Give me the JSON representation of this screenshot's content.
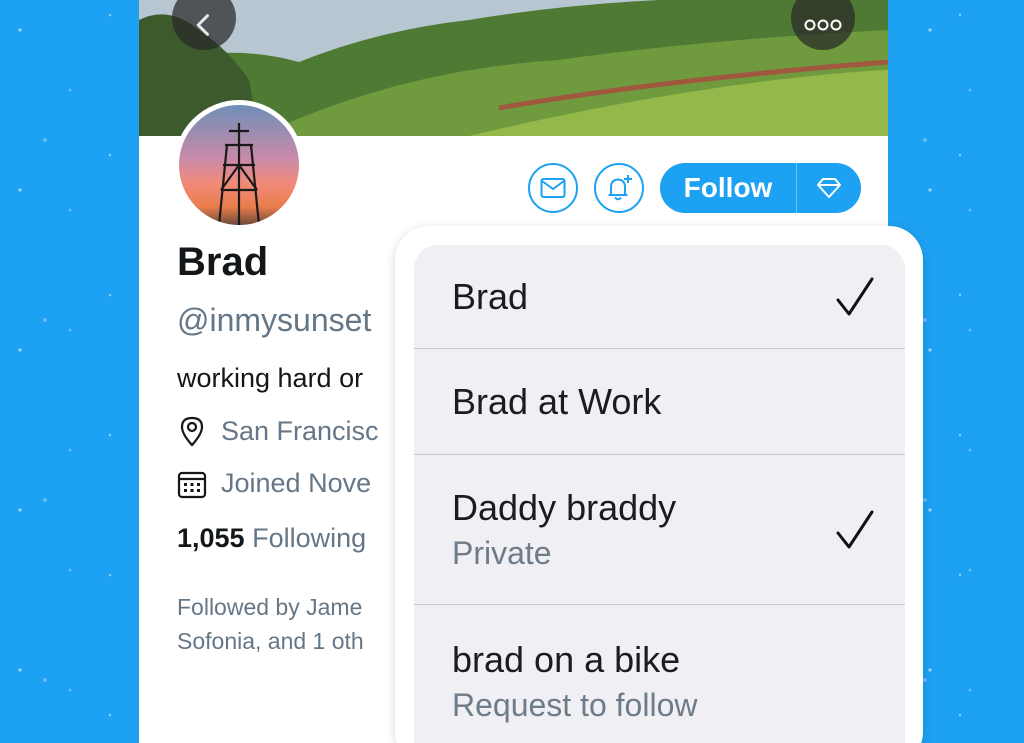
{
  "colors": {
    "brand": "#1DA1F2",
    "card": "#ffffff",
    "menu_bg": "#EFEFF4"
  },
  "header": {
    "back_icon": "chevron-left-icon",
    "more_icon": "more-horizontal-icon"
  },
  "actions": {
    "message_icon": "mail-icon",
    "notify_icon": "bell-plus-icon",
    "follow_label": "Follow",
    "super_icon": "diamond-icon"
  },
  "profile": {
    "name": "Brad",
    "handle": "@inmysunset",
    "bio": "working hard or",
    "location": "San Francisc",
    "joined": "Joined Nove",
    "following_count": "1,055",
    "following_label": "Following",
    "followed_by_line1": "Followed by Jame",
    "followed_by_line2": "Sofonia, and 1 oth"
  },
  "accounts": [
    {
      "name": "Brad",
      "subtitle": "",
      "checked": true
    },
    {
      "name": "Brad at Work",
      "subtitle": "",
      "checked": false
    },
    {
      "name": "Daddy braddy",
      "subtitle": "Private",
      "checked": true
    },
    {
      "name": "brad on a bike",
      "subtitle": "Request to follow",
      "checked": false
    }
  ]
}
